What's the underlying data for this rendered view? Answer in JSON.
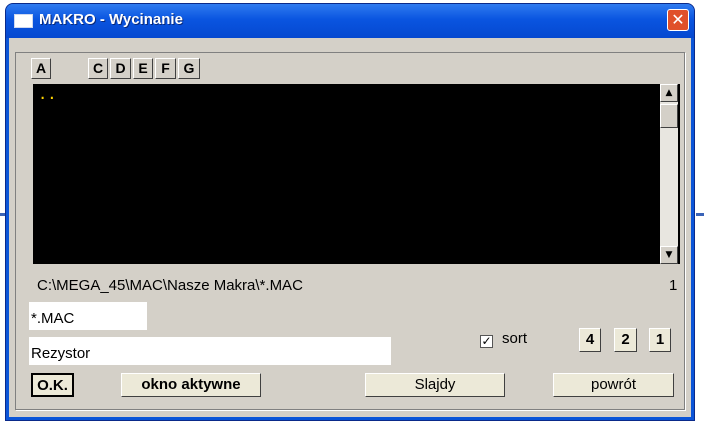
{
  "window": {
    "title": "MAKRO - Wycinanie",
    "close_glyph": "✕"
  },
  "drives": [
    "A",
    "C",
    "D",
    "E",
    "F",
    "G"
  ],
  "listing": {
    "entries": [
      ".."
    ]
  },
  "scrollbar": {
    "up_glyph": "▲",
    "down_glyph": "▼"
  },
  "path": {
    "text": "C:\\MEGA_45\\MAC\\Nasze Makra\\*.MAC",
    "count": "1"
  },
  "filter": {
    "value": "*.MAC"
  },
  "name": {
    "value": "Rezystor"
  },
  "sort": {
    "label": "sort",
    "checked": true,
    "check_glyph": "✓"
  },
  "page_buttons": [
    "4",
    "2",
    "1"
  ],
  "buttons": {
    "ok": "O.K.",
    "active_window": "okno aktywne",
    "slides": "Slajdy",
    "back": "powrót"
  }
}
